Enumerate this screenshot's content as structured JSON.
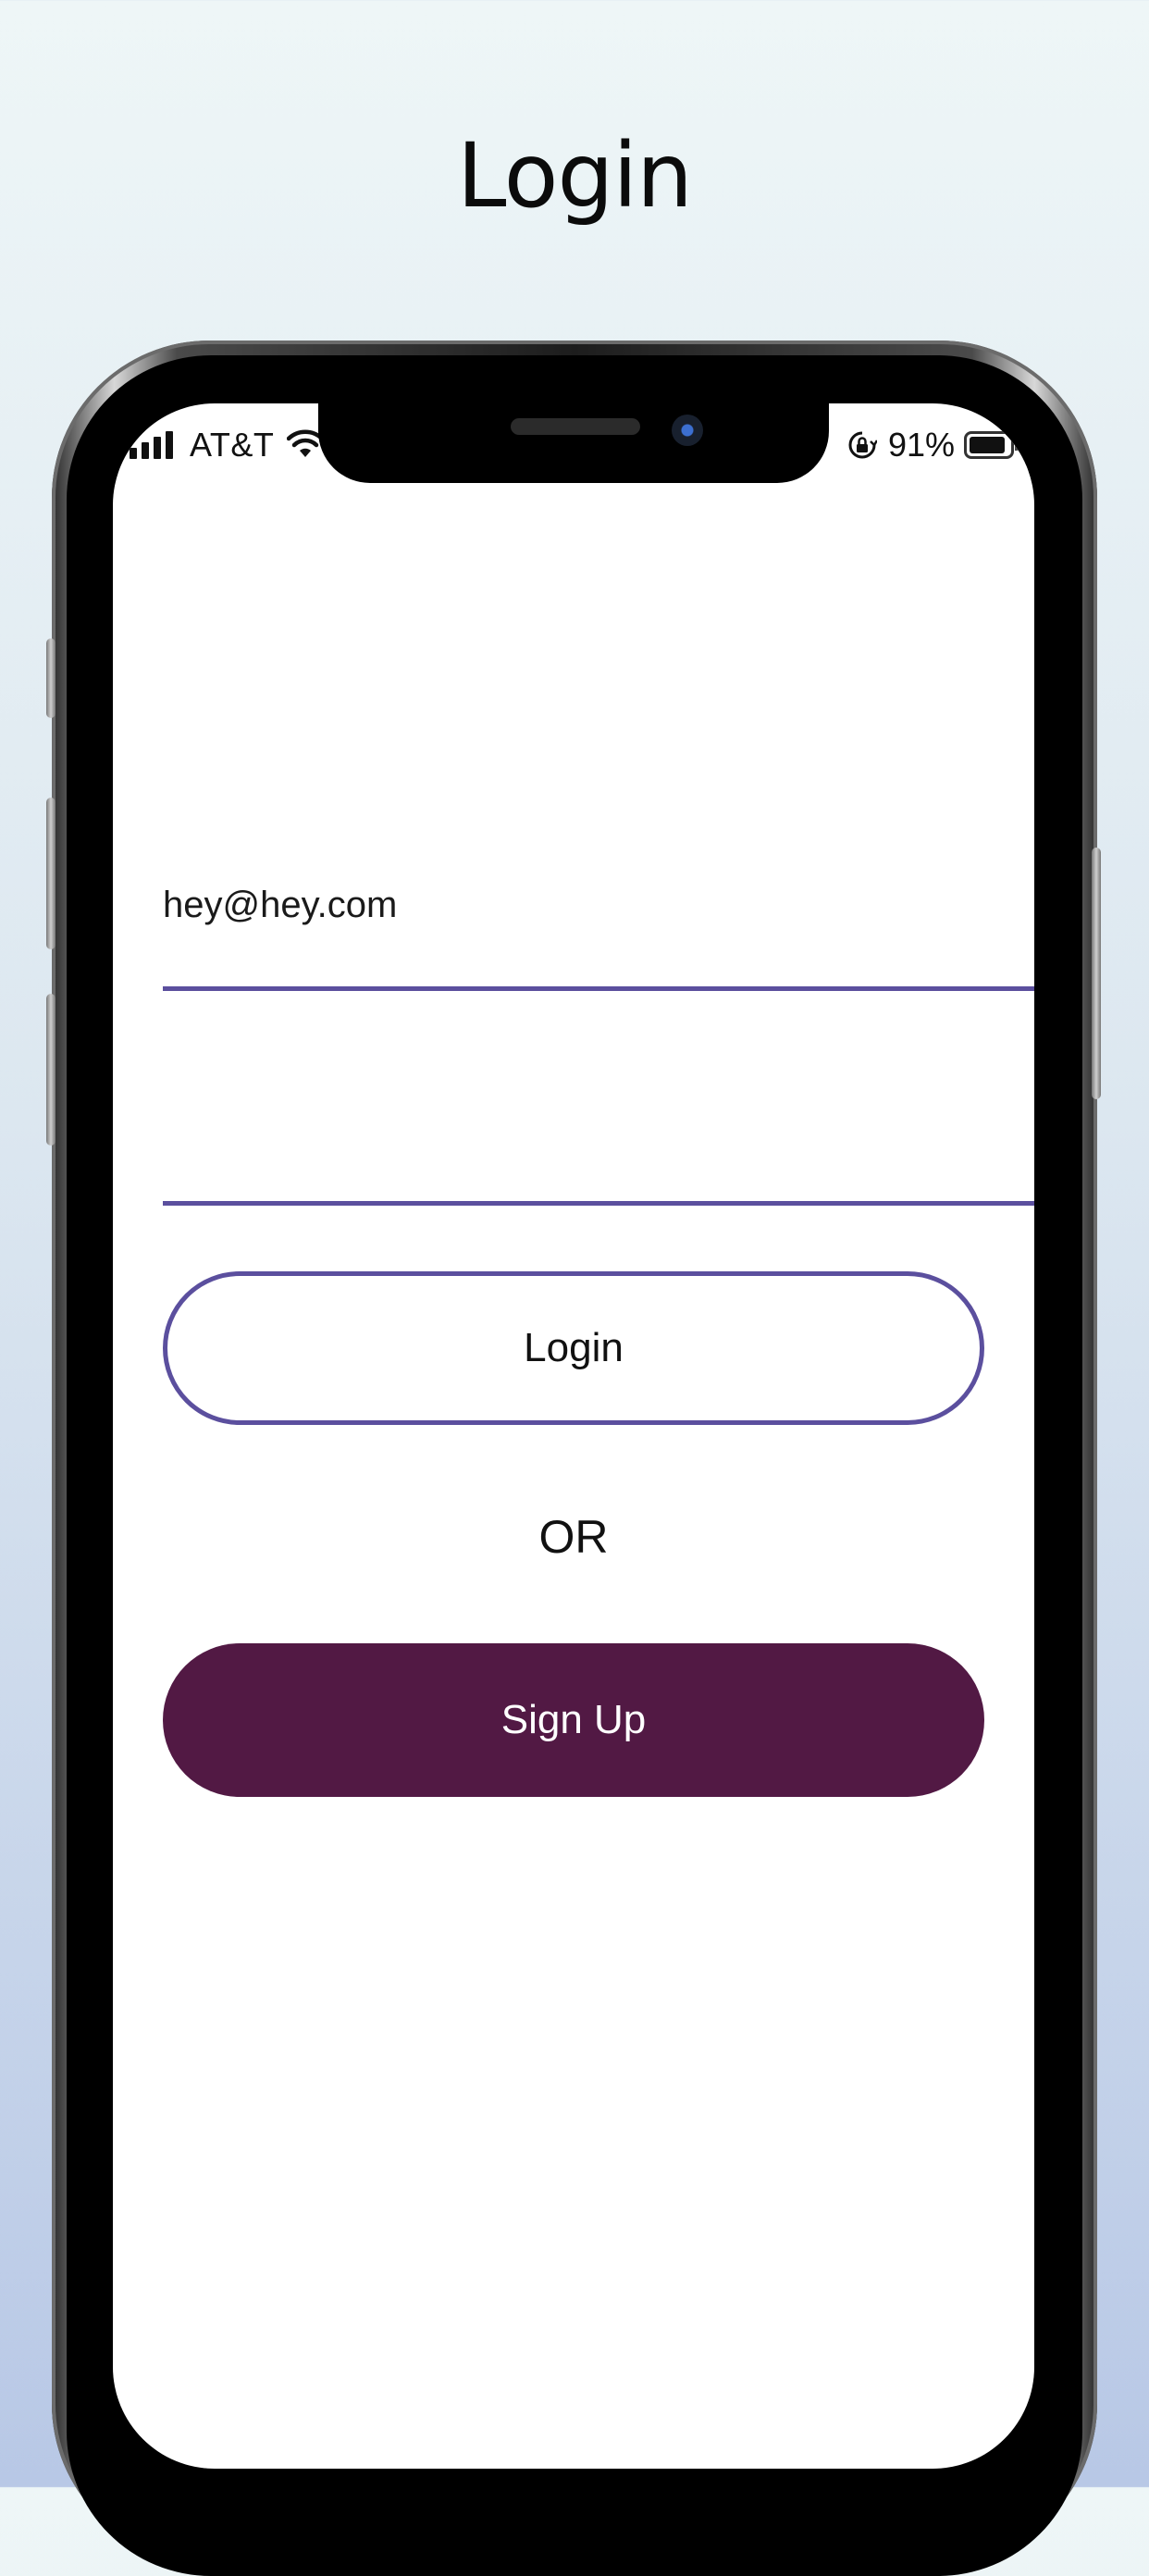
{
  "header": {
    "title": "Login"
  },
  "status_bar": {
    "carrier": "AT&T",
    "battery_percent": "91%",
    "battery_level": 0.91,
    "icons": [
      "signal-icon",
      "wifi-icon",
      "orientation-lock-icon",
      "battery-icon"
    ]
  },
  "form": {
    "email_value": "hey@hey.com",
    "password_value": ""
  },
  "actions": {
    "login_label": "Login",
    "divider_label": "OR",
    "signup_label": "Sign Up"
  },
  "colors": {
    "accent_line": "#5b4f9e",
    "signup_bg": "#521944",
    "background_top": "#eef6f7",
    "background_bottom": "#b8c8e6"
  }
}
